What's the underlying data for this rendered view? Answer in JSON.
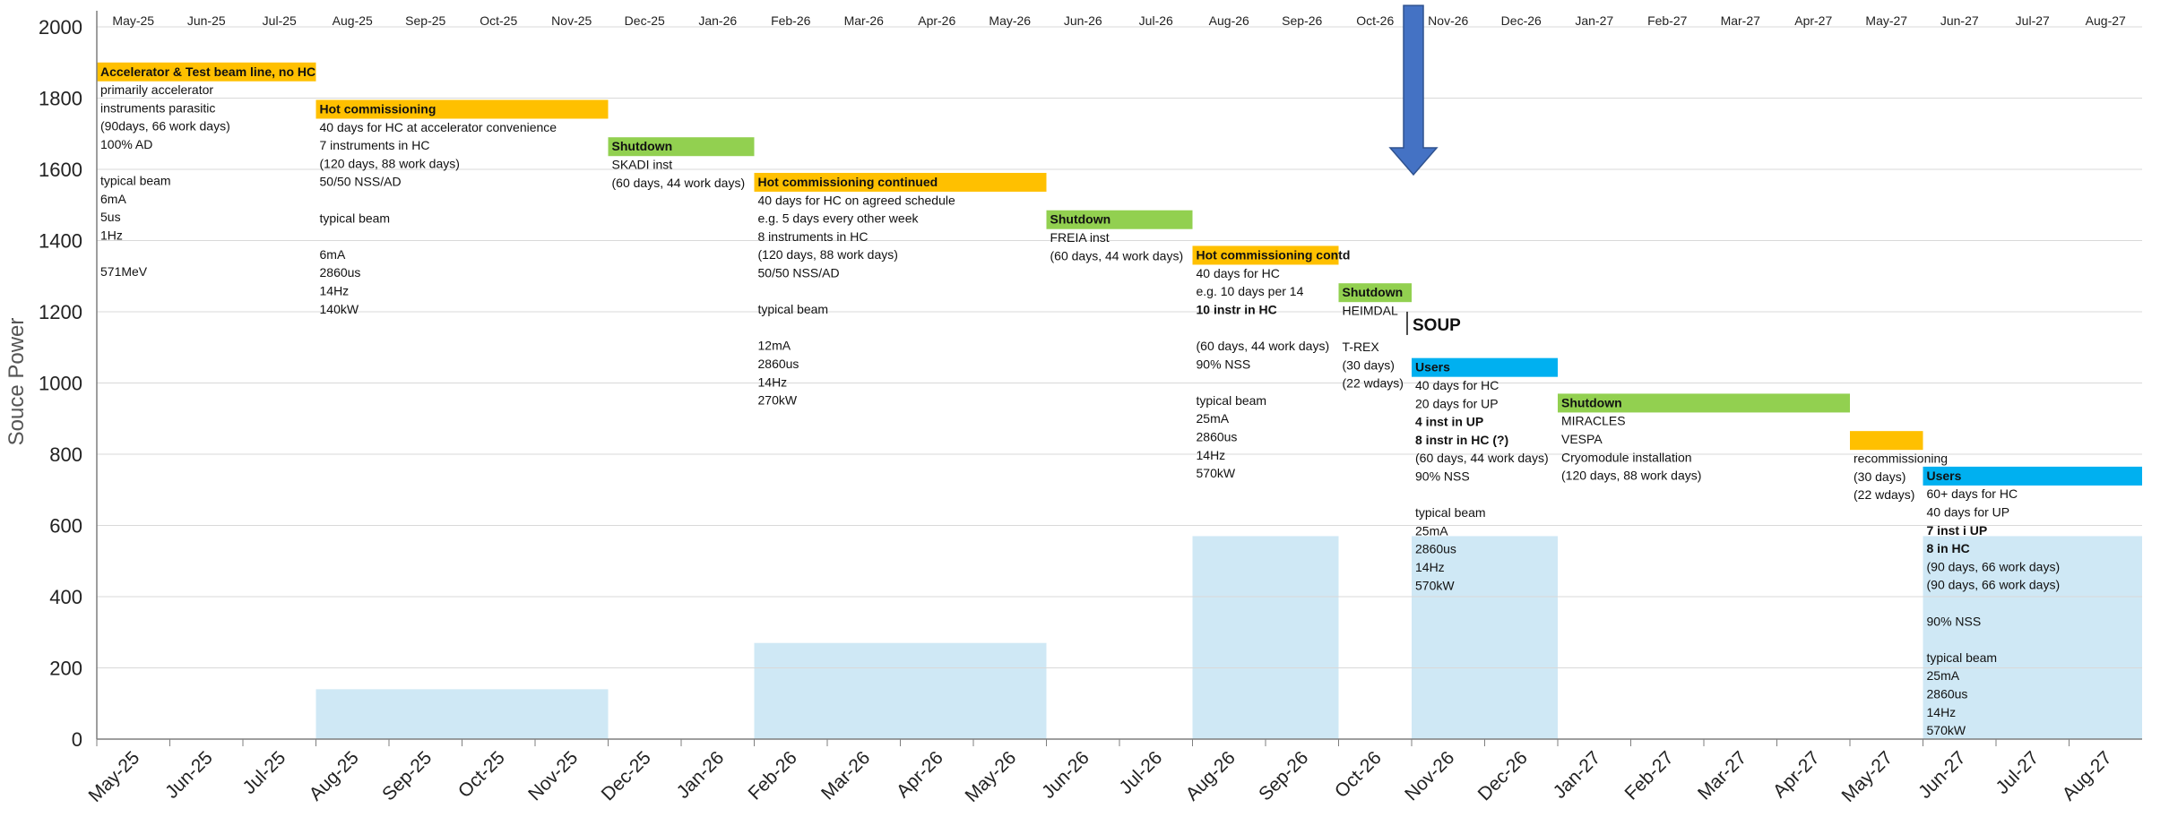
{
  "chart_data": {
    "type": "area",
    "ylabel": "Souce Power",
    "ylim": [
      0,
      2000
    ],
    "yticks": [
      0,
      200,
      400,
      600,
      800,
      1000,
      1200,
      1400,
      1600,
      1800,
      2000
    ],
    "months": [
      "May-25",
      "Jun-25",
      "Jul-25",
      "Aug-25",
      "Sep-25",
      "Oct-25",
      "Nov-25",
      "Dec-25",
      "Jan-26",
      "Feb-26",
      "Mar-26",
      "Apr-26",
      "May-26",
      "Jun-26",
      "Jul-26",
      "Aug-26",
      "Sep-26",
      "Oct-26",
      "Nov-26",
      "Dec-26",
      "Jan-27",
      "Feb-27",
      "Mar-27",
      "Apr-27",
      "May-27",
      "Jun-27",
      "Jul-27",
      "Aug-27"
    ],
    "grid": true,
    "power_blocks": [
      {
        "start": 3,
        "end": 7,
        "value": 140
      },
      {
        "start": 9,
        "end": 13,
        "value": 270
      },
      {
        "start": 15,
        "end": 17,
        "value": 570
      },
      {
        "start": 18,
        "end": 20,
        "value": 570
      },
      {
        "start": 25,
        "end": 28,
        "value": 570
      }
    ],
    "phases": [
      {
        "type": "commissioning",
        "start": 0,
        "end": 3,
        "y": 1900,
        "lines": [
          {
            "t": "Accelerator & Test beam line, no HC",
            "b": true
          },
          {
            "t": "primarily accelerator"
          },
          {
            "t": "instruments parasitic"
          },
          {
            "t": "(90days, 66 work days)"
          },
          {
            "t": "100% AD"
          },
          {
            "t": ""
          },
          {
            "t": "typical beam"
          },
          {
            "t": "6mA"
          },
          {
            "t": "5us"
          },
          {
            "t": "1Hz"
          },
          {
            "t": ""
          },
          {
            "t": "571MeV"
          }
        ]
      },
      {
        "type": "commissioning",
        "start": 3,
        "end": 7,
        "y": 1795,
        "lines": [
          {
            "t": "Hot commissioning",
            "b": true
          },
          {
            "t": "40 days for HC at accelerator convenience"
          },
          {
            "t": "7 instruments in HC"
          },
          {
            "t": "(120 days, 88 work days)"
          },
          {
            "t": "50/50 NSS/AD"
          },
          {
            "t": ""
          },
          {
            "t": "typical beam"
          },
          {
            "t": ""
          },
          {
            "t": "6mA"
          },
          {
            "t": "2860us"
          },
          {
            "t": "14Hz"
          },
          {
            "t": "140kW"
          }
        ]
      },
      {
        "type": "shutdown",
        "start": 7,
        "end": 9,
        "y": 1690,
        "lines": [
          {
            "t": "Shutdown",
            "b": true
          },
          {
            "t": "SKADI inst"
          },
          {
            "t": "(60 days, 44 work days)"
          }
        ]
      },
      {
        "type": "commissioning",
        "start": 9,
        "end": 13,
        "y": 1590,
        "lines": [
          {
            "t": "Hot commissioning continued",
            "b": true
          },
          {
            "t": "40 days for HC on agreed schedule"
          },
          {
            "t": "e.g. 5 days every other week"
          },
          {
            "t": "8 instruments in HC"
          },
          {
            "t": "(120 days, 88 work days)"
          },
          {
            "t": "50/50 NSS/AD"
          },
          {
            "t": ""
          },
          {
            "t": "typical beam"
          },
          {
            "t": ""
          },
          {
            "t": "12mA"
          },
          {
            "t": "2860us"
          },
          {
            "t": "14Hz"
          },
          {
            "t": "270kW"
          }
        ]
      },
      {
        "type": "shutdown",
        "start": 13,
        "end": 15,
        "y": 1485,
        "lines": [
          {
            "t": "Shutdown",
            "b": true
          },
          {
            "t": "FREIA inst"
          },
          {
            "t": "(60 days, 44 work days)"
          }
        ]
      },
      {
        "type": "commissioning",
        "start": 15,
        "end": 17,
        "y": 1385,
        "lines": [
          {
            "t": "Hot commissioning contd",
            "b": true
          },
          {
            "t": "40 days for HC"
          },
          {
            "t": "e.g. 10 days per 14"
          },
          {
            "t": "10 instr in HC",
            "b": true
          },
          {
            "t": ""
          },
          {
            "t": "(60 days, 44 work days)"
          },
          {
            "t": "90% NSS"
          },
          {
            "t": ""
          },
          {
            "t": "typical beam"
          },
          {
            "t": "25mA"
          },
          {
            "t": "2860us"
          },
          {
            "t": "14Hz"
          },
          {
            "t": "570kW"
          }
        ]
      },
      {
        "type": "shutdown",
        "start": 17,
        "end": 18,
        "y": 1280,
        "lines": [
          {
            "t": "Shutdown",
            "b": true
          },
          {
            "t": "HEIMDAL"
          },
          {
            "t": ""
          },
          {
            "t": "T-REX"
          },
          {
            "t": "(30 days)"
          },
          {
            "t": "(22 wdays)"
          }
        ]
      },
      {
        "type": "users",
        "start": 18,
        "end": 20,
        "y": 1070,
        "lines": [
          {
            "t": "Users",
            "b": true
          },
          {
            "t": "40 days for HC"
          },
          {
            "t": "20 days for UP"
          },
          {
            "t": "4 inst in UP",
            "b": true
          },
          {
            "t": "8 instr in HC (?)",
            "b": true
          },
          {
            "t": "(60 days, 44 work days)"
          },
          {
            "t": "90% NSS"
          },
          {
            "t": ""
          },
          {
            "t": "typical beam"
          },
          {
            "t": "25mA"
          },
          {
            "t": "2860us"
          },
          {
            "t": "14Hz"
          },
          {
            "t": "570kW"
          }
        ]
      },
      {
        "type": "shutdown",
        "start": 20,
        "end": 24,
        "y": 970,
        "lines": [
          {
            "t": "Shutdown",
            "b": true
          },
          {
            "t": "MIRACLES"
          },
          {
            "t": "VESPA"
          },
          {
            "t": "Cryomodule installation"
          },
          {
            "t": "(120 days, 88 work days)"
          }
        ]
      },
      {
        "type": "commissioning",
        "start": 24,
        "end": 25,
        "y": 865,
        "lines": [
          {
            "t": ""
          },
          {
            "t": "recommissioning"
          },
          {
            "t": "(30 days)"
          },
          {
            "t": "(22 wdays)"
          }
        ]
      },
      {
        "type": "users",
        "start": 25,
        "end": 28,
        "y": 765,
        "lines": [
          {
            "t": "Users",
            "b": true
          },
          {
            "t": "60+ days for HC"
          },
          {
            "t": "40 days for UP"
          },
          {
            "t": "7 inst i UP",
            "b": true
          },
          {
            "t": "8 in HC",
            "b": true
          },
          {
            "t": "(90 days, 66 work days)"
          },
          {
            "t": "(90 days, 66 work days)"
          },
          {
            "t": ""
          },
          {
            "t": "90% NSS"
          },
          {
            "t": ""
          },
          {
            "t": "typical beam"
          },
          {
            "t": "25mA"
          },
          {
            "t": "2860us"
          },
          {
            "t": "14Hz"
          },
          {
            "t": "570kW"
          }
        ]
      }
    ],
    "annotation": {
      "text": "SOUP",
      "month": 18,
      "y": 1165
    },
    "arrow": {
      "month": 18,
      "from": 2060,
      "to": 1585
    },
    "colors": {
      "commissioning": "#FFC000",
      "shutdown": "#92D050",
      "users": "#00B0F0",
      "power": "#CFE8F5",
      "arrow": "#4472C4",
      "arrow_edge": "#2F528F",
      "grid": "#D9D9D9",
      "axis": "#7F7F7F"
    }
  }
}
